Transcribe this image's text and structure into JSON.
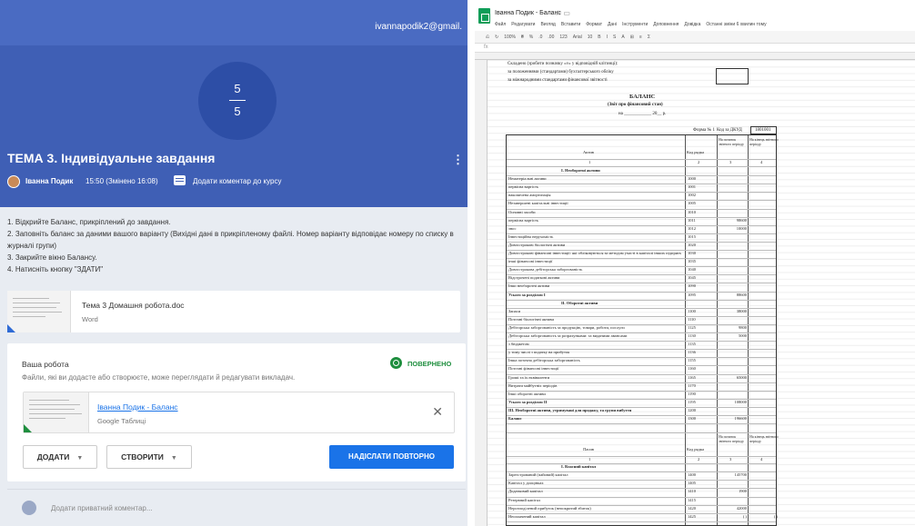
{
  "classroom": {
    "email": "ivannapodik2@gmail.",
    "score_num": "5",
    "score_den": "5",
    "title": "ТЕМА 3. Індивідуальне завдання",
    "author": "Іванна Подик",
    "time": "15:50 (Змінено 16:08)",
    "add_course_comment": "Додати коментар до курсу",
    "instructions": [
      "1. Відкрийте Баланс, прикріплений до завдання.",
      "2. Заповніть баланс за даними вашого варіанту (Вихідні дані в прикріпленому файлі. Номер варіанту відповідає номеру по списку в журналі групи)",
      "3. Закрийте вікно Балансу.",
      "4. Натисніть кнопку \"ЗДАТИ\""
    ],
    "attachment": {
      "name": "Тема 3 Домашня робота.doc",
      "type": "Word"
    },
    "your_work": {
      "title": "Ваша робота",
      "hint": "Файли, які ви додасте або створюєте, може переглядати й редагувати викладач.",
      "status": "ПОВЕРНЕНО",
      "file_name": "Іванна Подик - Баланс",
      "file_type": "Google Таблиці"
    },
    "buttons": {
      "add": "ДОДАТИ",
      "create": "СТВОРИТИ",
      "resend": "НАДІСЛАТИ ПОВТОРНО"
    },
    "private_comment_placeholder": "Додати приватний коментар..."
  },
  "sheet": {
    "doc_title": "Іванна Подик - Баланс",
    "menu": [
      "Файл",
      "Редагувати",
      "Вигляд",
      "Вставити",
      "Формат",
      "Дані",
      "Інструменти",
      "Доповнення",
      "Довідка",
      "Останні зміни 6 хвилин тому"
    ],
    "toolbar": [
      "⎌",
      "↻",
      "100%",
      "₴",
      "%",
      ".0",
      ".00",
      "123",
      "Arial",
      "10",
      "B",
      "I",
      "S",
      "A",
      "⊞",
      "≡",
      "Σ"
    ],
    "header_lines": [
      "Складено (зробити позначку «v» у відповідній клітинці):",
      "за положеннями (стандартами) бухгалтерського обліку",
      "за міжнародними стандартами фінансової звітності"
    ],
    "report_title": "БАЛАНС",
    "report_subtitle": "(Звіт про фінансовий стан)",
    "report_date": "на ____________ 20__ р.",
    "form_label": "Форма № 1",
    "dkud_label": "Код за ДКУД",
    "dkud_code": "1801001",
    "col_headers": {
      "asset": "Актив",
      "code": "Код рядка",
      "start": "На початок звітного періоду",
      "end": "На кінець звітного періоду"
    },
    "col_numbers": [
      "1",
      "2",
      "3",
      "4"
    ],
    "rows": [
      {
        "label": "I. Необоротні активи",
        "code": "",
        "start": "",
        "end": "",
        "bold": true
      },
      {
        "label": "Нематеріальні активи",
        "code": "1000",
        "start": "",
        "end": ""
      },
      {
        "label": "первісна вартість",
        "code": "1001",
        "start": "",
        "end": ""
      },
      {
        "label": "накопичена амортизація",
        "code": "1002",
        "start": "",
        "end": ""
      },
      {
        "label": "Незавершені капітальні інвестиції",
        "code": "1005",
        "start": "",
        "end": ""
      },
      {
        "label": "Основні засоби",
        "code": "1010",
        "start": "",
        "end": ""
      },
      {
        "label": "первісна вартість",
        "code": "1011",
        "start": "98600",
        "end": ""
      },
      {
        "label": "знос",
        "code": "1012",
        "start": "10000",
        "end": ""
      },
      {
        "label": "Інвестиційна нерухомість",
        "code": "1015",
        "start": "",
        "end": ""
      },
      {
        "label": "Довгострокові біологічні активи",
        "code": "1020",
        "start": "",
        "end": ""
      },
      {
        "label": "Довгострокові фінансові інвестиції: які обліковуються за методом участі в капіталі інших підприємств",
        "code": "1030",
        "start": "",
        "end": ""
      },
      {
        "label": "інші фінансові інвестиції",
        "code": "1035",
        "start": "",
        "end": ""
      },
      {
        "label": "Довгострокова дебіторська заборгованість",
        "code": "1040",
        "start": "",
        "end": ""
      },
      {
        "label": "Відстрочені податкові активи",
        "code": "1045",
        "start": "",
        "end": ""
      },
      {
        "label": "Інші необоротні активи",
        "code": "1090",
        "start": "",
        "end": ""
      },
      {
        "label": "Усього за розділом I",
        "code": "1095",
        "start": "88600",
        "end": "",
        "bold": true
      },
      {
        "label": "II. Оборотні активи",
        "code": "",
        "start": "",
        "end": "",
        "bold": true
      },
      {
        "label": "Запаси",
        "code": "1100",
        "start": "38000",
        "end": ""
      },
      {
        "label": "Поточні біологічні активи",
        "code": "1110",
        "start": "",
        "end": ""
      },
      {
        "label": "Дебіторська заборгованість за продукцію, товари, роботи, послуги",
        "code": "1125",
        "start": "9800",
        "end": ""
      },
      {
        "label": "Дебіторська заборгованість за розрахунками: за виданими авансами",
        "code": "1130",
        "start": "5000",
        "end": ""
      },
      {
        "label": "з бюджетом",
        "code": "1135",
        "start": "",
        "end": ""
      },
      {
        "label": "у тому числі з податку на прибуток",
        "code": "1136",
        "start": "",
        "end": ""
      },
      {
        "label": "Інша поточна дебіторська заборгованість",
        "code": "1155",
        "start": "",
        "end": ""
      },
      {
        "label": "Поточні фінансові інвестиції",
        "code": "1160",
        "start": "",
        "end": ""
      },
      {
        "label": "Гроші та їх еквіваленти",
        "code": "1165",
        "start": "65000",
        "end": ""
      },
      {
        "label": "Витрати майбутніх періодів",
        "code": "1170",
        "start": "",
        "end": ""
      },
      {
        "label": "Інші оборотні активи",
        "code": "1190",
        "start": "",
        "end": ""
      },
      {
        "label": "Усього за розділом II",
        "code": "1195",
        "start": "108000",
        "end": "",
        "bold": true
      },
      {
        "label": "III. Необоротні активи, утримувані для продажу, та групи вибуття",
        "code": "1200",
        "start": "",
        "end": "",
        "bold": true
      },
      {
        "label": "Баланс",
        "code": "1300",
        "start": "196600",
        "end": "",
        "bold": true
      }
    ],
    "col_headers2": {
      "liab": "Пасив",
      "code": "Код рядка",
      "start": "На початок звітного періоду",
      "end": "На кінець звітного періоду"
    },
    "rows2": [
      {
        "label": "I. Власний капітал",
        "code": "",
        "start": "",
        "end": "",
        "bold": true
      },
      {
        "label": "Зареєстрований (пайовий) капітал",
        "code": "1400",
        "start": "145700",
        "end": ""
      },
      {
        "label": "Капітал у дооцінках",
        "code": "1405",
        "start": "",
        "end": ""
      },
      {
        "label": "Додатковий капітал",
        "code": "1410",
        "start": "1900",
        "end": ""
      },
      {
        "label": "Резервний капітал",
        "code": "1415",
        "start": "",
        "end": ""
      },
      {
        "label": "Нерозподілений прибуток (непокритий збиток)",
        "code": "1420",
        "start": "42000",
        "end": ""
      },
      {
        "label": "Неоплачений капітал",
        "code": "1425",
        "start": "(  )",
        "end": "(  )"
      }
    ]
  }
}
